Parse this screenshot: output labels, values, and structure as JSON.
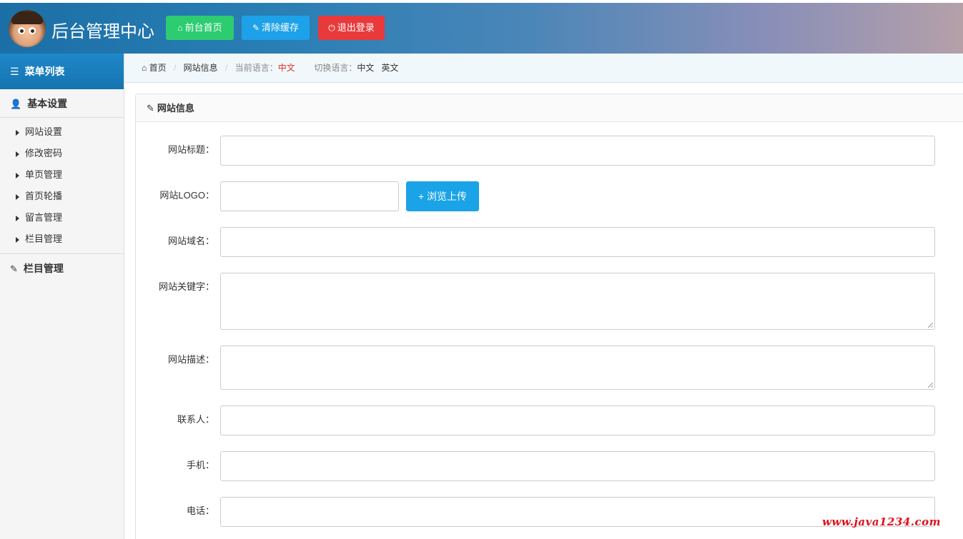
{
  "header": {
    "title": "后台管理中心",
    "buttons": {
      "home": "前台首页",
      "cache": "清除缓存",
      "logout": "退出登录"
    },
    "icons": {
      "home": "home-icon",
      "cache": "wrench-icon",
      "logout": "power-icon"
    }
  },
  "sidebar": {
    "menu_title": "菜单列表",
    "sections": [
      {
        "title": "基本设置",
        "items": [
          "网站设置",
          "修改密码",
          "单页管理",
          "首页轮播",
          "留言管理",
          "栏目管理"
        ]
      },
      {
        "title": "栏目管理",
        "items": []
      }
    ]
  },
  "breadcrumb": {
    "home": "首页",
    "current": "网站信息",
    "lang_label": "当前语言：",
    "lang_value": "中文",
    "switch_label": "切换语言：",
    "switch_zh": "中文",
    "switch_en": "英文"
  },
  "panel": {
    "title": "网站信息",
    "fields": [
      {
        "label": "网站标题：",
        "value": ""
      },
      {
        "label": "网站LOGO：",
        "value": ""
      },
      {
        "label": "网站域名：",
        "value": ""
      },
      {
        "label": "网站关键字：",
        "value": ""
      },
      {
        "label": "网站描述：",
        "value": ""
      },
      {
        "label": "联系人：",
        "value": ""
      },
      {
        "label": "手机：",
        "value": ""
      },
      {
        "label": "电话：",
        "value": ""
      }
    ],
    "upload_label": "+ 浏览上传"
  },
  "watermark": "www.java1234.com",
  "colors": {
    "btn_home": "#2ecc71",
    "btn_cache": "#1da1e8",
    "btn_logout": "#e8393b",
    "upload": "#1aa3e6",
    "current_lang": "#d9302c"
  }
}
